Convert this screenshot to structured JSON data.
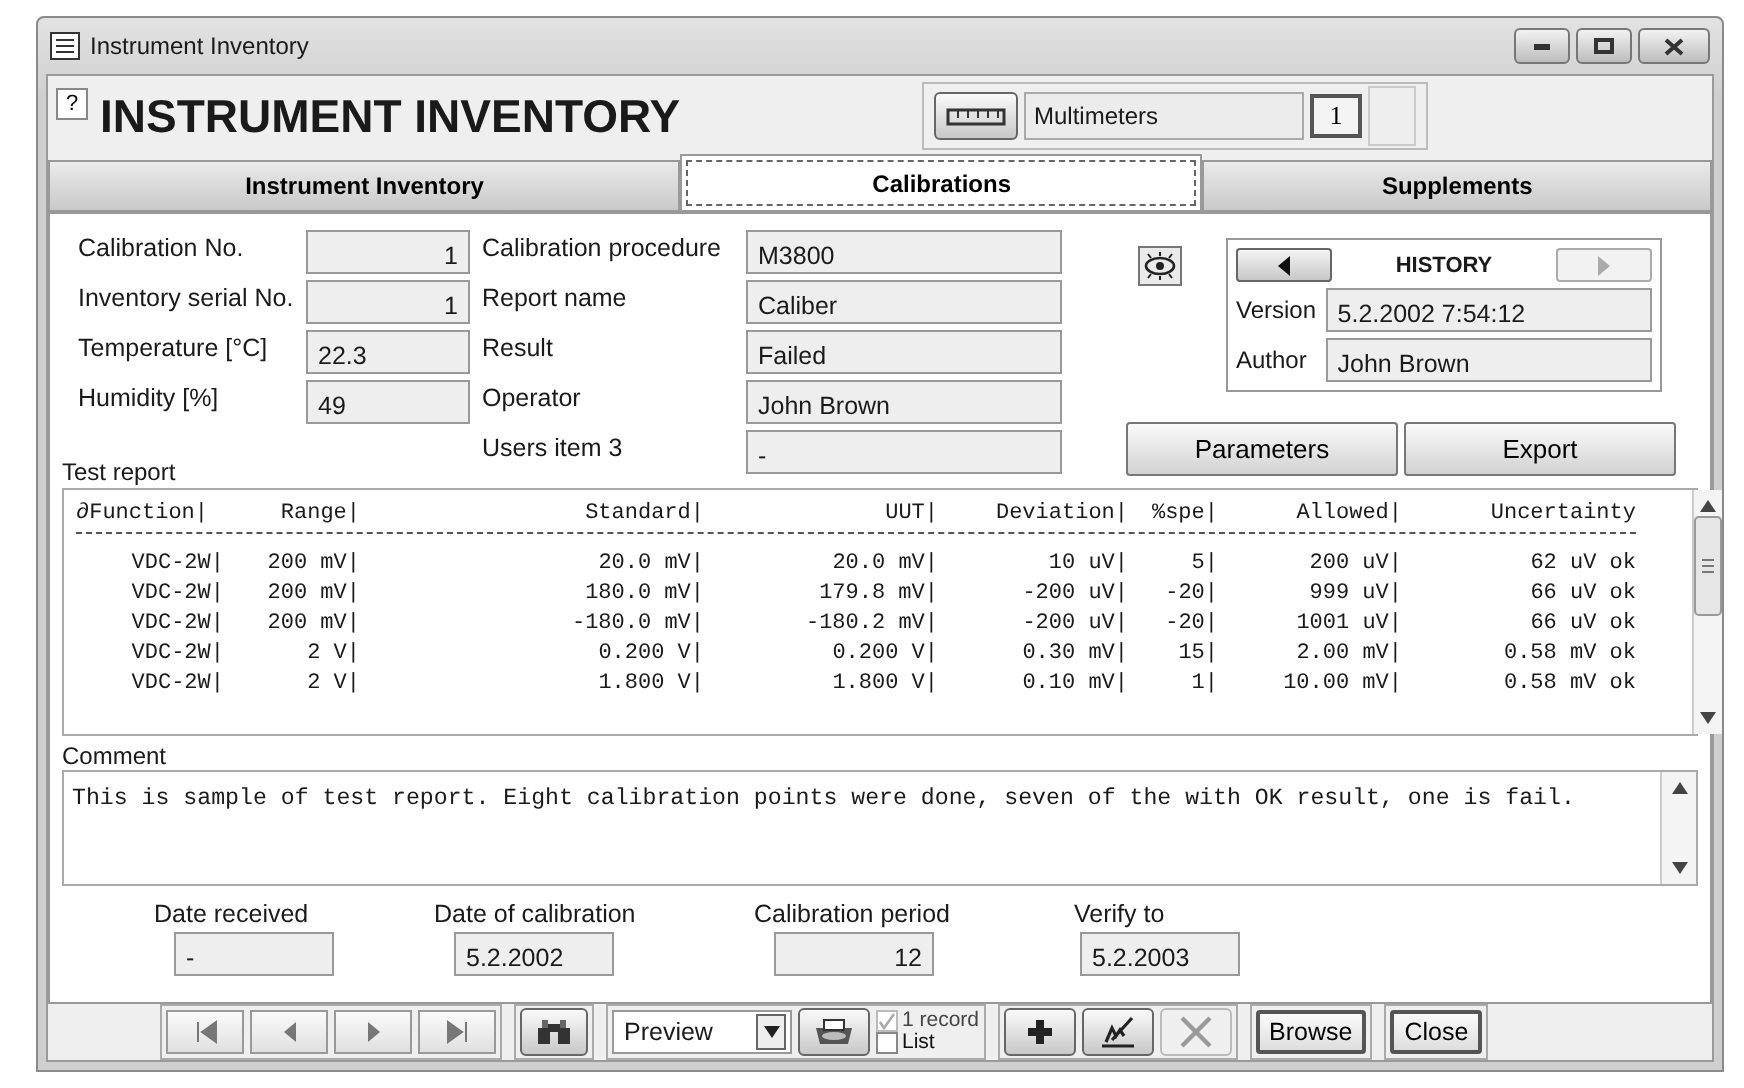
{
  "window": {
    "title": "Instrument Inventory"
  },
  "header": {
    "help": "?",
    "title": "INSTRUMENT INVENTORY",
    "category": "Multimeters",
    "count": "1"
  },
  "tabs": [
    {
      "label": "Instrument Inventory",
      "selected": false
    },
    {
      "label": "Calibrations",
      "selected": true
    },
    {
      "label": "Supplements",
      "selected": false
    }
  ],
  "fields_left": [
    {
      "label": "Calibration No.",
      "value": "1",
      "kind": "number"
    },
    {
      "label": "Inventory serial No.",
      "value": "1",
      "kind": "number"
    },
    {
      "label": "Temperature  [°C]",
      "value": "22.3",
      "kind": "text"
    },
    {
      "label": "Humidity  [%]",
      "value": "49",
      "kind": "text"
    }
  ],
  "fields_middle": [
    {
      "label": "Calibration procedure",
      "value": "M3800"
    },
    {
      "label": "Report name",
      "value": "Caliber"
    },
    {
      "label": "Result",
      "value": "Failed"
    },
    {
      "label": "Operator",
      "value": "John Brown"
    },
    {
      "label": "Users item 3",
      "value": "-"
    }
  ],
  "history": {
    "title": "HISTORY",
    "prev_enabled": true,
    "next_enabled": false,
    "version_label": "Version",
    "version": "5.2.2002 7:54:12",
    "author_label": "Author",
    "author": "John Brown"
  },
  "actions": [
    "Parameters",
    "Export"
  ],
  "test_report": {
    "label": "Test report",
    "columns": [
      "∂Function|",
      "Range|",
      "Standard|",
      "UUT|",
      "Deviation|",
      "%spe|",
      "Allowed|",
      "Uncertainty"
    ],
    "rows": [
      [
        "VDC-2W|",
        "200 mV|",
        "20.0 mV|",
        "20.0 mV|",
        "10 uV|",
        "5|",
        "200 uV|",
        "62 uV ok"
      ],
      [
        "VDC-2W|",
        "200 mV|",
        "180.0 mV|",
        "179.8 mV|",
        "-200 uV|",
        "-20|",
        "999 uV|",
        "66 uV ok"
      ],
      [
        "VDC-2W|",
        "200 mV|",
        "-180.0 mV|",
        "-180.2 mV|",
        "-200 uV|",
        "-20|",
        "1001 uV|",
        "66 uV ok"
      ],
      [
        "VDC-2W|",
        "2 V|",
        "0.200 V|",
        "0.200 V|",
        "0.30 mV|",
        "15|",
        "2.00 mV|",
        "0.58 mV ok"
      ],
      [
        "VDC-2W|",
        "2 V|",
        "1.800 V|",
        "1.800 V|",
        "0.10 mV|",
        "1|",
        "10.00 mV|",
        "0.58 mV ok"
      ]
    ]
  },
  "comment": {
    "label": "Comment",
    "text": "This is sample of test report. Eight calibration points were done, seven of the with OK result, one is fail."
  },
  "dates": [
    {
      "label": "Date received",
      "value": "-",
      "kind": "text"
    },
    {
      "label": "Date of calibration",
      "value": "5.2.2002",
      "kind": "text"
    },
    {
      "label": "Calibration period",
      "value": "12",
      "kind": "number"
    },
    {
      "label": "Verify to",
      "value": "5.2.2003",
      "kind": "text"
    }
  ],
  "toolbar": {
    "preview": "Preview",
    "options": [
      {
        "label": "1 record",
        "checked": true,
        "disabled": true
      },
      {
        "label": "List",
        "checked": false,
        "disabled": false
      }
    ],
    "record_buttons": [
      {
        "kind": "add",
        "disabled": false
      },
      {
        "kind": "edit",
        "disabled": false
      },
      {
        "kind": "delete",
        "disabled": true
      }
    ],
    "buttons": [
      "Browse",
      "Close"
    ]
  }
}
